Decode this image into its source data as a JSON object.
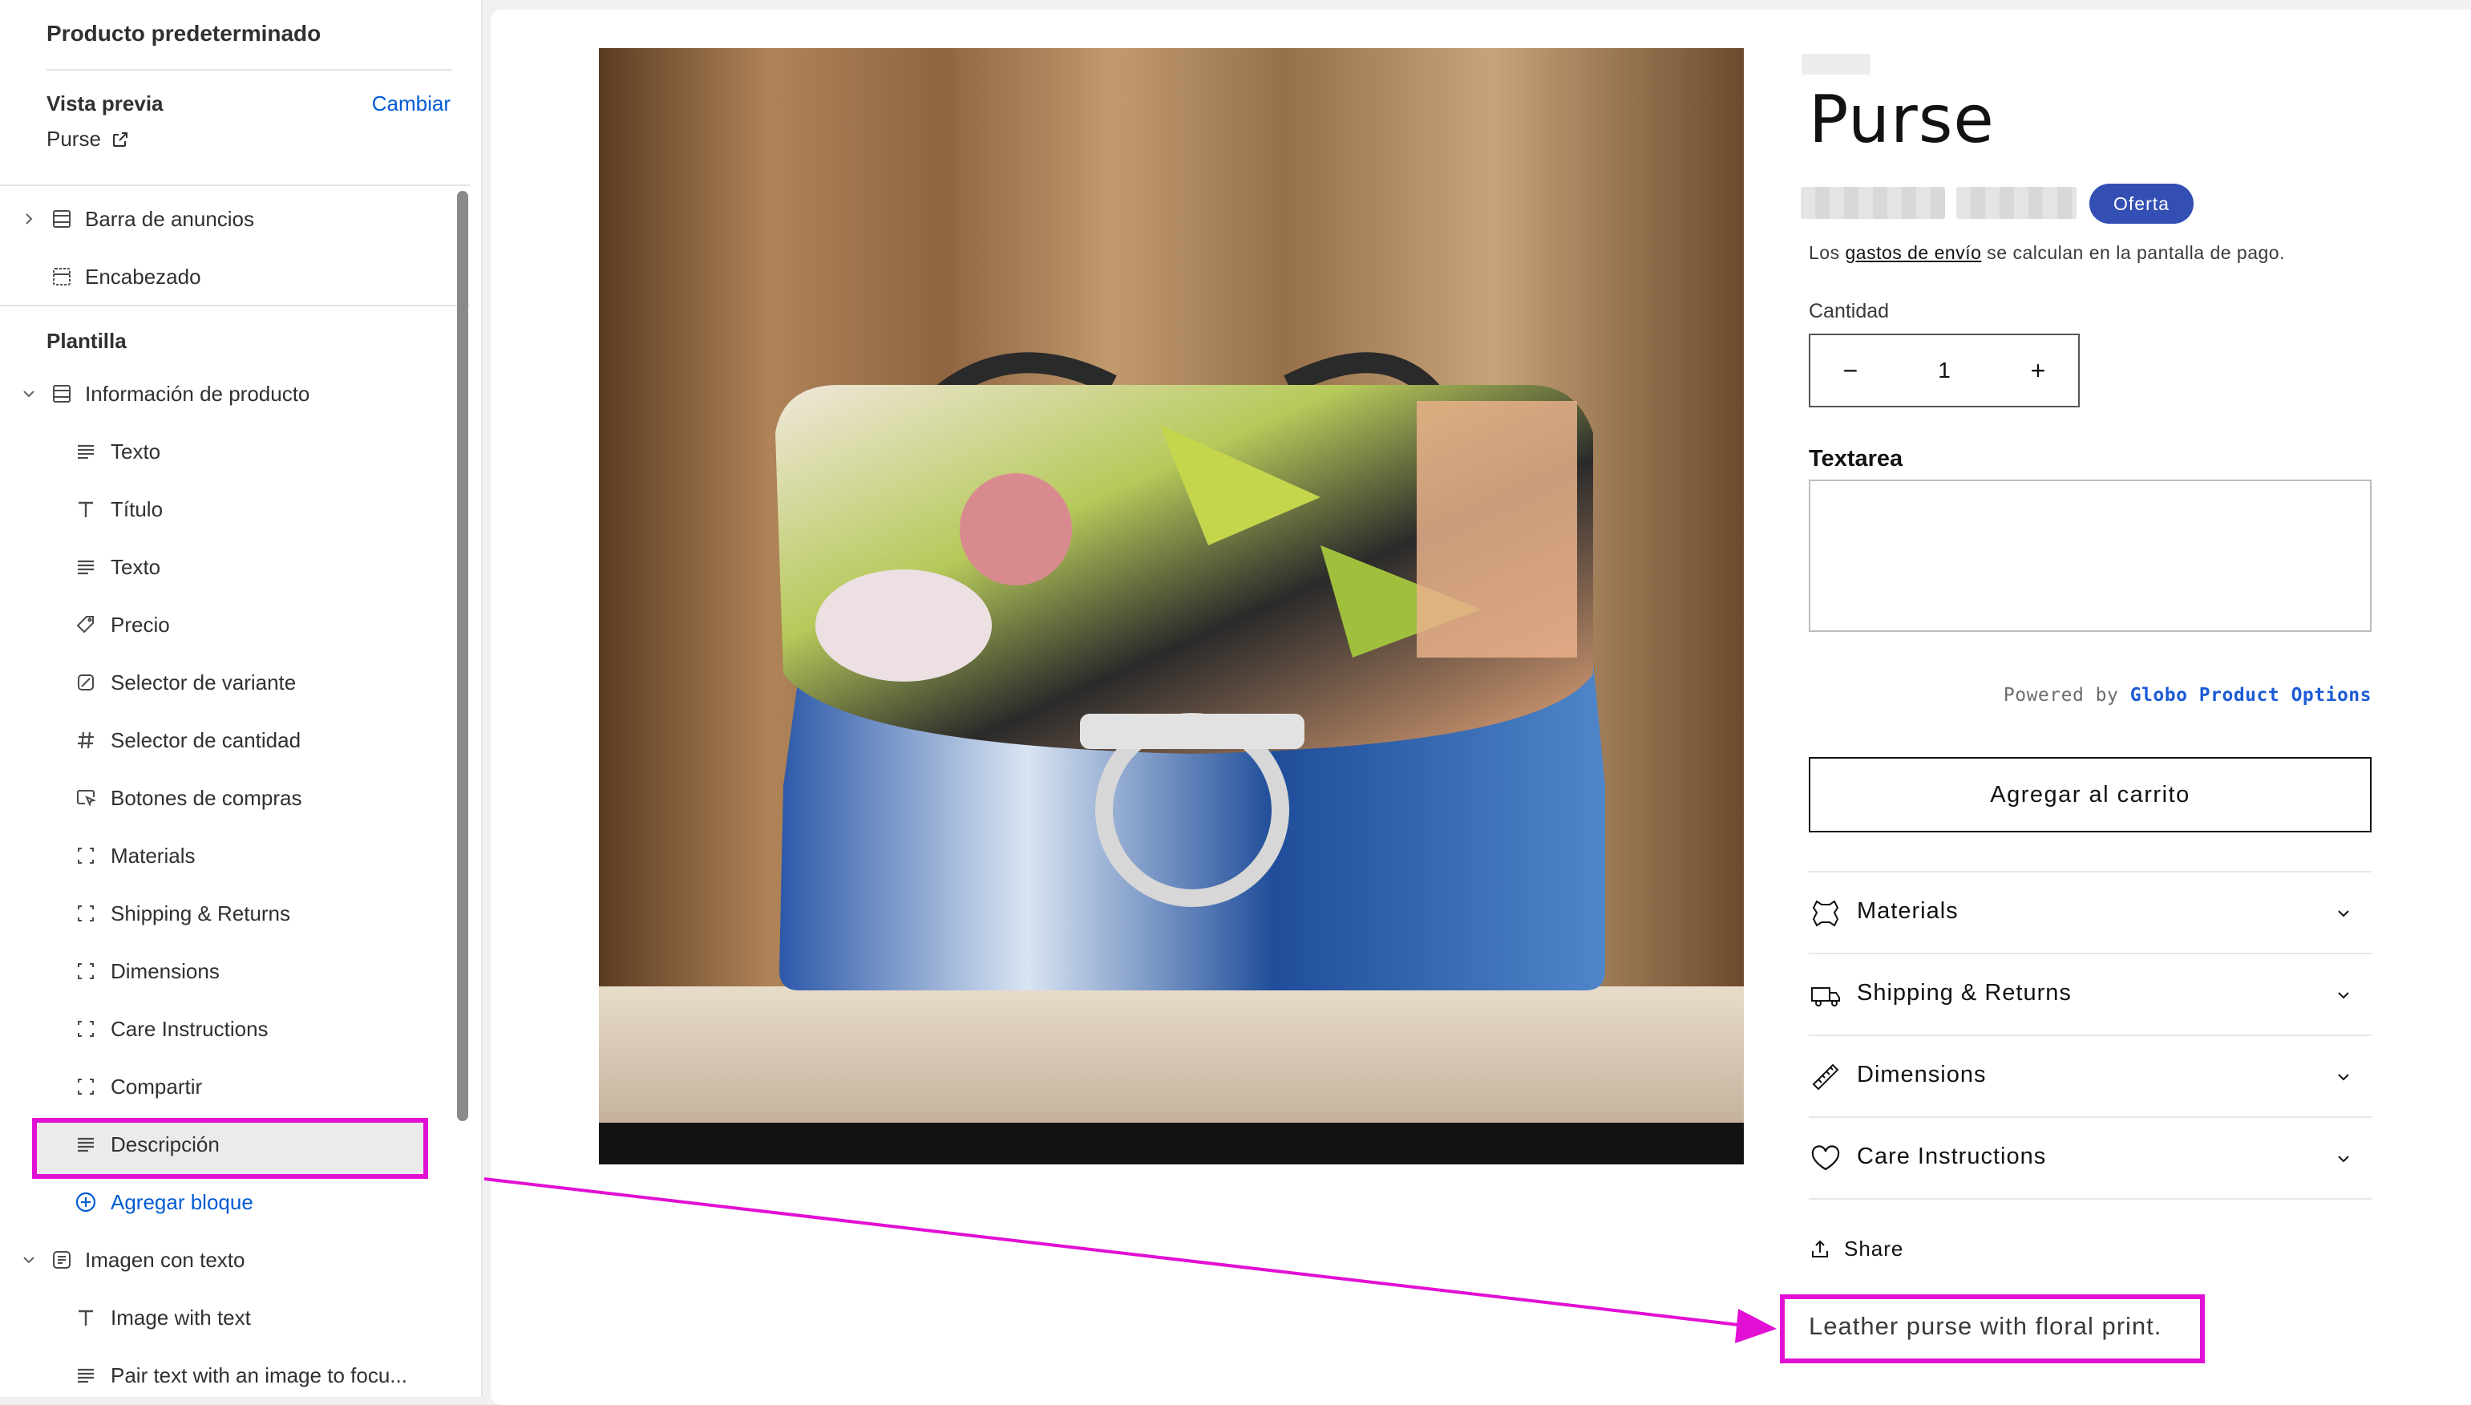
{
  "sidebar": {
    "title": "Producto predeterminado",
    "preview_label": "Vista previa",
    "preview_change": "Cambiar",
    "preview_value": "Purse",
    "header_items": [
      {
        "label": "Barra de anuncios",
        "icon": "layout-icon"
      },
      {
        "label": "Encabezado",
        "icon": "layout-icon"
      }
    ],
    "template_heading": "Plantilla",
    "product_info": {
      "label": "Información de producto",
      "blocks": [
        {
          "label": "Texto",
          "icon": "text-lines-icon"
        },
        {
          "label": "Título",
          "icon": "title-t-icon"
        },
        {
          "label": "Texto",
          "icon": "text-lines-icon"
        },
        {
          "label": "Precio",
          "icon": "price-tag-icon"
        },
        {
          "label": "Selector de variante",
          "icon": "variant-icon"
        },
        {
          "label": "Selector de cantidad",
          "icon": "hash-icon"
        },
        {
          "label": "Botones de compras",
          "icon": "cursor-click-icon"
        },
        {
          "label": "Materials",
          "icon": "collapsible-icon"
        },
        {
          "label": "Shipping & Returns",
          "icon": "collapsible-icon"
        },
        {
          "label": "Dimensions",
          "icon": "collapsible-icon"
        },
        {
          "label": "Care Instructions",
          "icon": "collapsible-icon"
        },
        {
          "label": "Compartir",
          "icon": "collapsible-icon"
        },
        {
          "label": "Descripción",
          "icon": "text-lines-icon"
        }
      ],
      "add_block": "Agregar bloque"
    },
    "image_with_text": {
      "label": "Imagen con texto",
      "blocks": [
        {
          "label": "Image with text",
          "icon": "title-t-icon"
        },
        {
          "label": "Pair text with an image to focu...",
          "icon": "text-lines-icon"
        }
      ]
    }
  },
  "product": {
    "title": "Purse",
    "badge": "Oferta",
    "shipping_prefix": "Los ",
    "shipping_link": "gastos de envío",
    "shipping_suffix": " se calculan en la pantalla de pago.",
    "quantity_label": "Cantidad",
    "quantity_value": "1",
    "quantity_minus": "−",
    "quantity_plus": "+",
    "textarea_label": "Textarea",
    "powered_prefix": "Powered by ",
    "powered_brand": "Globo Product Options",
    "add_to_cart": "Agregar al carrito",
    "accordions": [
      {
        "label": "Materials",
        "icon": "leather-icon"
      },
      {
        "label": "Shipping & Returns",
        "icon": "truck-icon"
      },
      {
        "label": "Dimensions",
        "icon": "ruler-icon"
      },
      {
        "label": "Care Instructions",
        "icon": "heart-icon"
      }
    ],
    "share": "Share",
    "description": "Leather purse with floral print."
  },
  "colors": {
    "accent_link": "#005bd3",
    "badge": "#334fb4",
    "annotation": "#e20fd4",
    "powered_brand": "#1d5bd6"
  }
}
